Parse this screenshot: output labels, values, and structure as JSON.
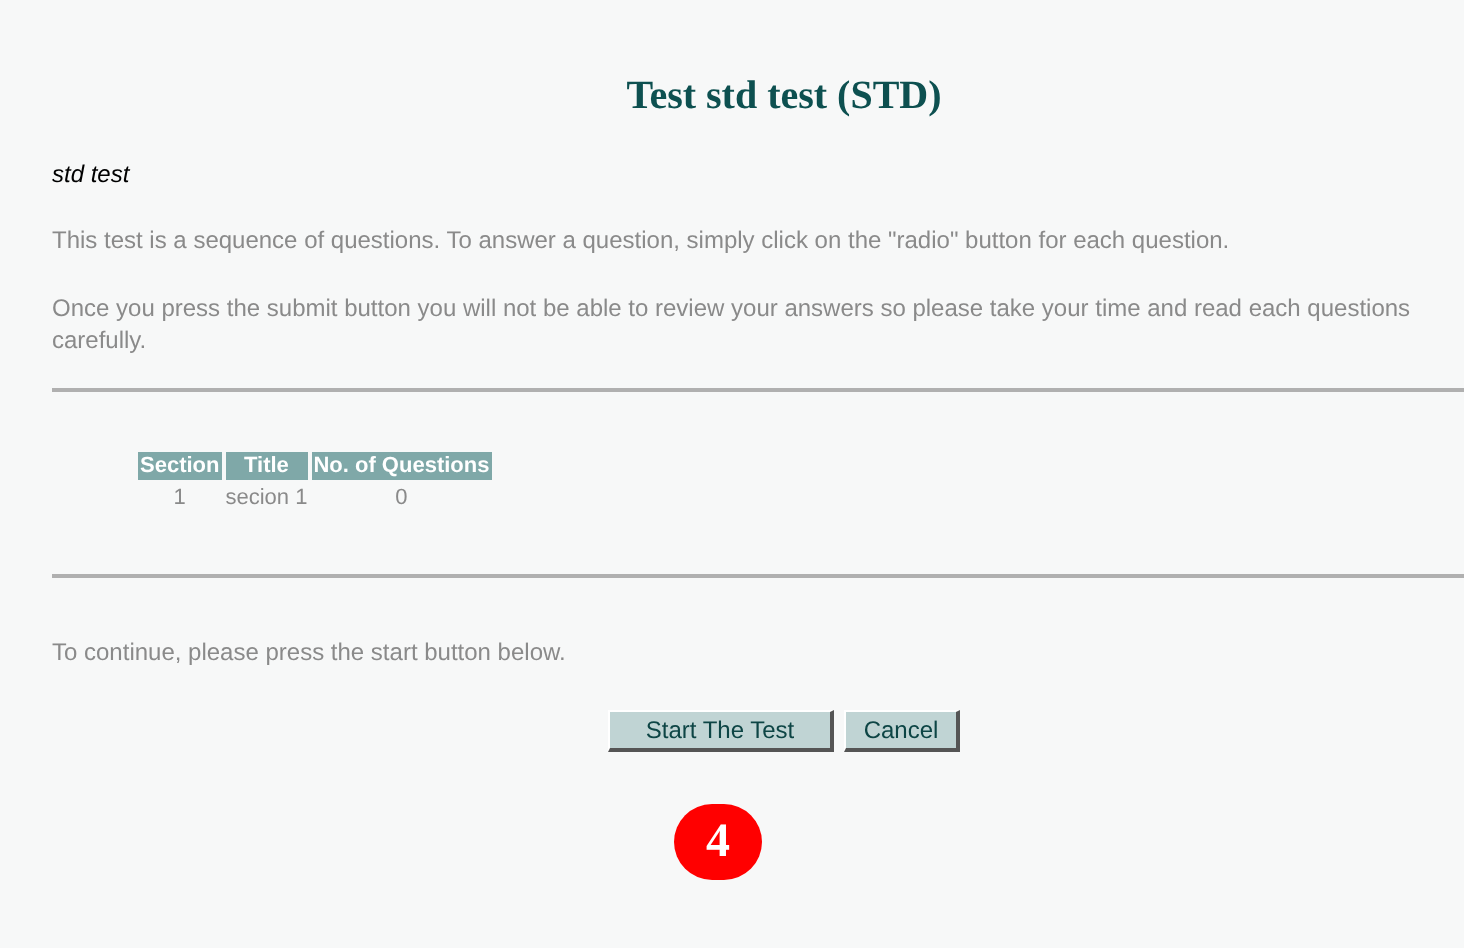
{
  "title": "Test std test (STD)",
  "subtitle": "std test",
  "paragraphs": [
    "This test is a sequence of questions. To answer a question, simply click on the \"radio\" button for each question.",
    "Once you press the submit button you will not be able to review your answers so please take your time and read each questions carefully."
  ],
  "table": {
    "columns": [
      "Section",
      "Title",
      "No. of Questions"
    ],
    "rows": [
      [
        "1",
        "secion 1",
        "0"
      ]
    ]
  },
  "instruction": "To continue, please press the start button below.",
  "buttons": [
    "Start The Test",
    "Cancel"
  ],
  "badge": "4"
}
